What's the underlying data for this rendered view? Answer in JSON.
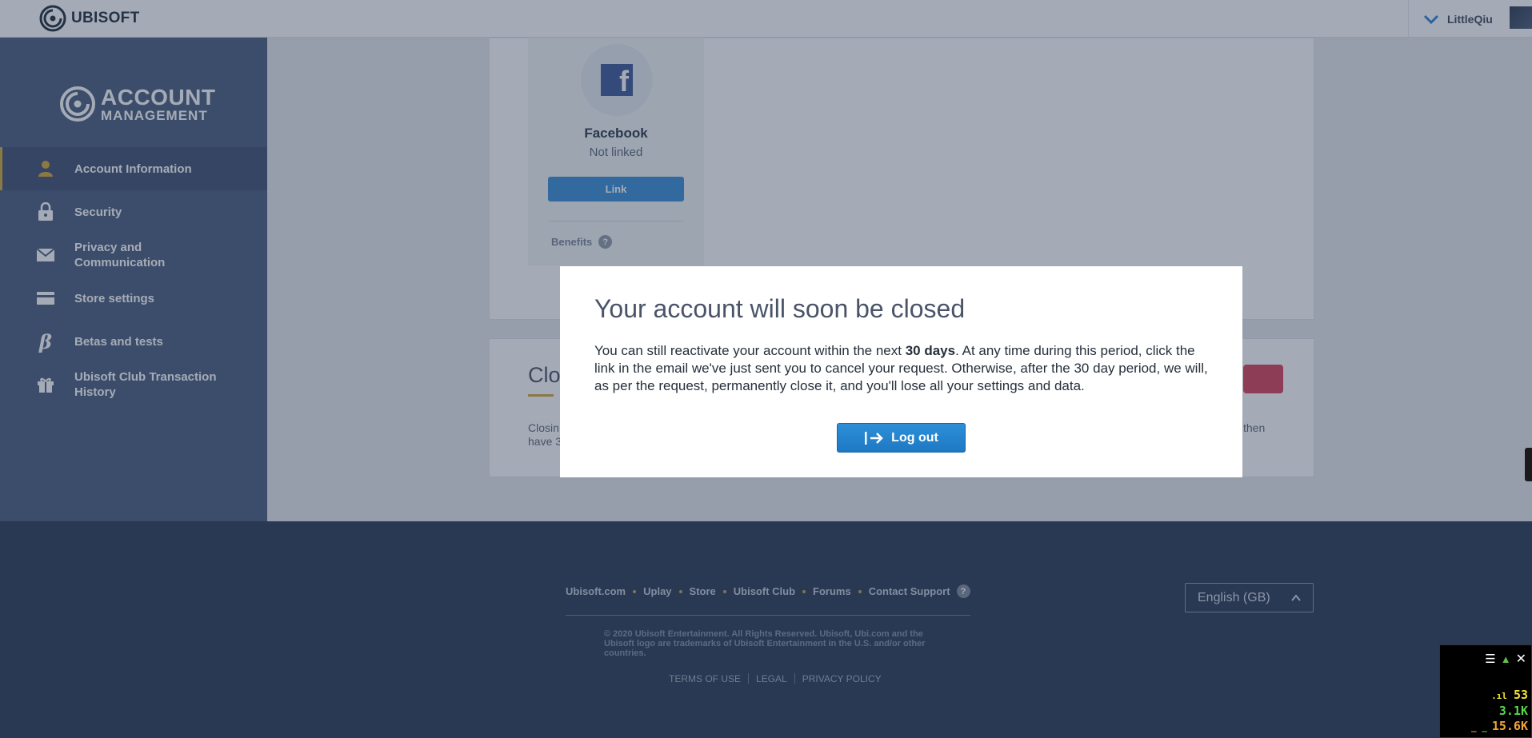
{
  "topbar": {
    "brand": "UBISOFT",
    "username": "LittleQiu"
  },
  "sidebar": {
    "logo_line1": "ACCOUNT",
    "logo_line2": "MANAGEMENT",
    "items": [
      {
        "label": "Account Information",
        "icon": "user-icon",
        "active": true
      },
      {
        "label": "Security",
        "icon": "lock-icon",
        "active": false
      },
      {
        "label": "Privacy and Communication",
        "icon": "envelope-icon",
        "active": false
      },
      {
        "label": "Store settings",
        "icon": "card-icon",
        "active": false
      },
      {
        "label": "Betas and tests",
        "icon": "beta-icon",
        "active": false
      },
      {
        "label": "Ubisoft Club Transaction History",
        "icon": "gift-icon",
        "active": false
      }
    ]
  },
  "social": {
    "facebook_name": "Facebook",
    "facebook_status": "Not linked",
    "link_button": "Link",
    "benefits": "Benefits",
    "benefits_help": "?"
  },
  "close_account": {
    "title_visible": "Clo",
    "text_left": "Closin have 3",
    "text_right": "then"
  },
  "modal": {
    "title": "Your account will soon be closed",
    "body_pre": "You can still reactivate your account within the next ",
    "body_bold": "30 days",
    "body_post": ". At any time during this period, click the link in the email we've just sent you to cancel your request. Otherwise, after the 30 day period, we will, as per the request, permanently close it, and you'll lose all your settings and data.",
    "logout_button": "Log out"
  },
  "footer": {
    "links": [
      "Ubisoft.com",
      "Uplay",
      "Store",
      "Ubisoft Club",
      "Forums",
      "Contact Support"
    ],
    "help": "?",
    "copyright": "© 2020 Ubisoft Entertainment. All Rights Reserved. Ubisoft, Ubi.com and the Ubisoft logo are trademarks of Ubisoft Entertainment in the U.S. and/or other countries.",
    "legal": [
      "TERMS OF USE",
      "LEGAL",
      "PRIVACY POLICY"
    ],
    "language": "English (GB)"
  },
  "perf_widget": {
    "fps": "53",
    "value2": "3.1K",
    "value3": "15.6K"
  },
  "colors": {
    "accent_gold": "#d2a93c",
    "primary_blue": "#1e78c4",
    "sidebar": "#4a5d7e",
    "footer": "#2a3a55"
  }
}
